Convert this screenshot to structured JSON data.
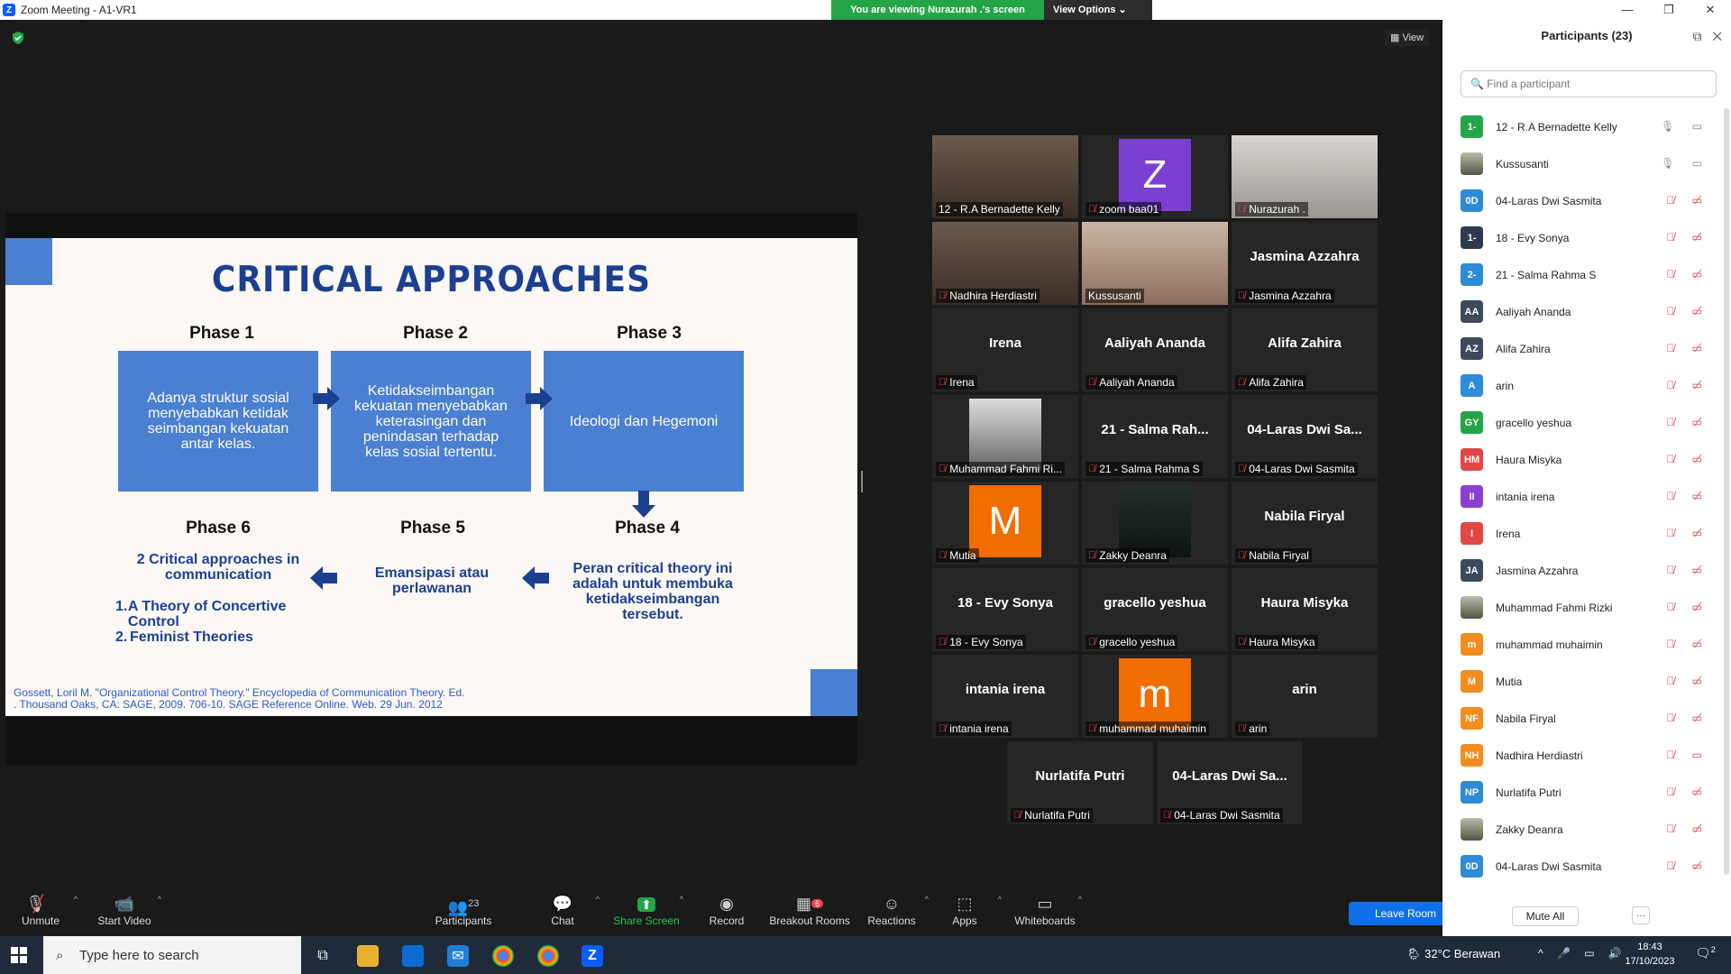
{
  "window": {
    "title": "Zoom Meeting - A1-VR1",
    "controls": [
      "—",
      "❐",
      "✕"
    ]
  },
  "banner": {
    "viewing": "You are viewing Nurazurah .'s screen",
    "view_options": "View Options"
  },
  "view_button": "View",
  "slide": {
    "title": "CRITICAL APPROACHES",
    "phase1": "Phase 1",
    "phase2": "Phase 2",
    "phase3": "Phase 3",
    "phase4": "Phase 4",
    "phase5": "Phase 5",
    "phase6": "Phase 6",
    "box1": "Adanya struktur sosial menyebabkan ketidak seimbangan kekuatan antar kelas.",
    "box2": "Ketidakseimbangan kekuatan menyebabkan keterasingan dan penindasan terhadap kelas sosial tertentu.",
    "box3": "Ideologi dan Hegemoni",
    "p4": "Peran critical theory ini adalah untuk membuka ketidakseimbangan tersebut.",
    "p5": "Emansipasi atau perlawanan",
    "p6": "2 Critical approaches in communication",
    "p6_item1": "A Theory of Concertive Control",
    "p6_item2": "Feminist Theories",
    "citation_line1": "Gossett, Loril M. \"Organizational Control Theory.\" Encyclopedia of Communication Theory. Ed.",
    "citation_line2": ". Thousand Oaks, CA: SAGE, 2009. 706-10. SAGE Reference Online. Web. 29 Jun. 2012"
  },
  "tiles": [
    {
      "big": "",
      "label": "12 - R.A Bernadette Kelly",
      "type": "video",
      "muted": false
    },
    {
      "big": "Z",
      "label": "zoom baa01",
      "type": "avatar",
      "color": "#7b3fd1",
      "muted": true
    },
    {
      "big": "",
      "label": "Nurazurah .",
      "type": "video",
      "muted": true
    },
    {
      "big": "",
      "label": "Nadhira Herdiastri",
      "type": "video",
      "muted": true
    },
    {
      "big": "",
      "label": "Kussusanti",
      "type": "video",
      "muted": false
    },
    {
      "big": "Jasmina Azzahra",
      "label": "Jasmina Azzahra",
      "type": "name",
      "muted": true
    },
    {
      "big": "Irena",
      "label": "Irena",
      "type": "name",
      "muted": true
    },
    {
      "big": "Aaliyah Ananda",
      "label": "Aaliyah Ananda",
      "type": "name",
      "muted": true
    },
    {
      "big": "Alifa Zahira",
      "label": "Alifa Zahira",
      "type": "name",
      "muted": true
    },
    {
      "big": "",
      "label": "Muhammad Fahmi Ri...",
      "type": "photo",
      "muted": true
    },
    {
      "big": "21 - Salma Rah...",
      "label": "21 - Salma Rahma S",
      "type": "name",
      "muted": true
    },
    {
      "big": "04-Laras Dwi Sa...",
      "label": "04-Laras Dwi Sasmita",
      "type": "name",
      "muted": true
    },
    {
      "big": "M",
      "label": "Mutia",
      "type": "avatar",
      "color": "#f26d00",
      "muted": true
    },
    {
      "big": "",
      "label": "Zakky Deanra",
      "type": "dark",
      "muted": true
    },
    {
      "big": "Nabila Firyal",
      "label": "Nabila Firyal",
      "type": "name",
      "muted": true
    },
    {
      "big": "18 - Evy Sonya",
      "label": "18 - Evy Sonya",
      "type": "name",
      "muted": true
    },
    {
      "big": "gracello yeshua",
      "label": "gracello yeshua",
      "type": "name",
      "muted": true
    },
    {
      "big": "Haura Misyka",
      "label": "Haura Misyka",
      "type": "name",
      "muted": true
    },
    {
      "big": "intania irena",
      "label": "intania irena",
      "type": "name",
      "muted": true
    },
    {
      "big": "m",
      "label": "muhammad muhaimin",
      "type": "avatar",
      "color": "#f26d00",
      "muted": true
    },
    {
      "big": "arin",
      "label": "arin",
      "type": "name",
      "muted": true
    },
    {
      "big": "Nurlatifa Putri",
      "label": "Nurlatifa Putri",
      "type": "name",
      "muted": true
    },
    {
      "big": "04-Laras Dwi Sa...",
      "label": "04-Laras Dwi Sasmita",
      "type": "name",
      "muted": true
    }
  ],
  "toolbar": {
    "unmute": "Unmute",
    "start_video": "Start Video",
    "participants": "Participants",
    "participants_count": "23",
    "chat": "Chat",
    "share_screen": "Share Screen",
    "record": "Record",
    "breakout": "Breakout Rooms",
    "breakout_badge": "6",
    "reactions": "Reactions",
    "apps": "Apps",
    "whiteboards": "Whiteboards",
    "leave": "Leave Room"
  },
  "panel": {
    "title": "Participants (23)",
    "search_placeholder": "Find a participant",
    "mute_all": "Mute All",
    "more": "···",
    "participants": [
      {
        "initials": "1-",
        "name": "12 - R.A Bernadette Kelly",
        "color": "#23a548",
        "muted": false
      },
      {
        "initials": "",
        "name": "Kussusanti",
        "color": "#5a3e36",
        "muted": false,
        "photo": true
      },
      {
        "initials": "0D",
        "name": "04-Laras Dwi Sasmita",
        "color": "#2d8bd8",
        "muted": true
      },
      {
        "initials": "1-",
        "name": "18 - Evy Sonya",
        "color": "#2e3b4e",
        "muted": true
      },
      {
        "initials": "2-",
        "name": "21 - Salma Rahma S",
        "color": "#2d8bd8",
        "muted": true
      },
      {
        "initials": "AA",
        "name": "Aaliyah Ananda",
        "color": "#3c4a5c",
        "muted": true
      },
      {
        "initials": "AZ",
        "name": "Alifa Zahira",
        "color": "#3c4a5c",
        "muted": true
      },
      {
        "initials": "A",
        "name": "arin",
        "color": "#2d8bd8",
        "muted": true
      },
      {
        "initials": "GY",
        "name": "gracello yeshua",
        "color": "#23a548",
        "muted": true
      },
      {
        "initials": "HM",
        "name": "Haura Misyka",
        "color": "#e04848",
        "muted": true
      },
      {
        "initials": "II",
        "name": "intania irena",
        "color": "#8a3fd1",
        "muted": true
      },
      {
        "initials": "I",
        "name": "Irena",
        "color": "#e04848",
        "muted": true
      },
      {
        "initials": "JA",
        "name": "Jasmina Azzahra",
        "color": "#3c4a5c",
        "muted": true
      },
      {
        "initials": "",
        "name": "Muhammad Fahmi Rizki",
        "color": "#aaaaaa",
        "muted": true,
        "photo": true
      },
      {
        "initials": "m",
        "name": "muhammad muhaimin",
        "color": "#f28c1e",
        "muted": true
      },
      {
        "initials": "M",
        "name": "Mutia",
        "color": "#f28c1e",
        "muted": true
      },
      {
        "initials": "NF",
        "name": "Nabila Firyal",
        "color": "#f28c1e",
        "muted": true
      },
      {
        "initials": "NH",
        "name": "Nadhira Herdiastri",
        "color": "#f28c1e",
        "muted": true,
        "video_on": true
      },
      {
        "initials": "NP",
        "name": "Nurlatifa Putri",
        "color": "#2d8bd8",
        "muted": true
      },
      {
        "initials": "",
        "name": "Zakky Deanra",
        "color": "#2a3a2a",
        "muted": true,
        "photo": true
      },
      {
        "initials": "0D",
        "name": "04-Laras Dwi Sasmita",
        "color": "#2d8bd8",
        "muted": true
      }
    ]
  },
  "taskbar": {
    "search_placeholder": "Type here to search",
    "weather": "32°C  Berawan",
    "time": "18:43",
    "date": "17/10/2023",
    "notification_count": "2"
  }
}
